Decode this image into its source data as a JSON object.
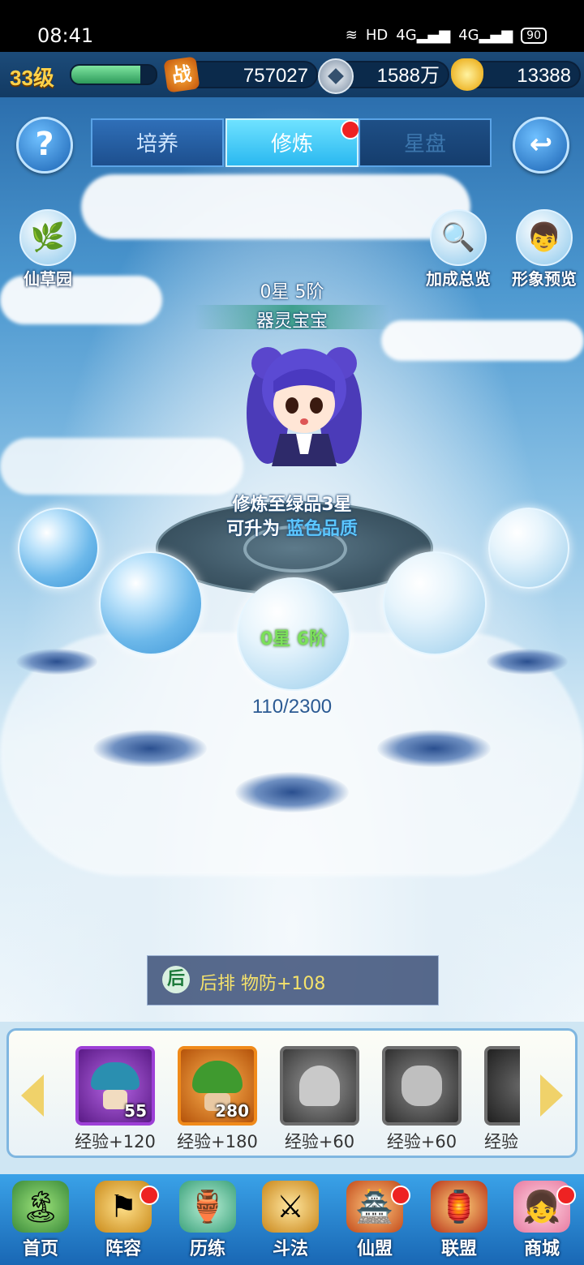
{
  "status_bar": {
    "time": "08:41",
    "network": "HD",
    "signal1": "4G",
    "signal2": "4G",
    "battery": "90"
  },
  "resources": {
    "level": "33级",
    "xp_fraction": 0.82,
    "combat_icon_text": "战",
    "combat_power": "757027",
    "silver": "1588万",
    "gold": "13388"
  },
  "tabs": [
    {
      "label": "培养",
      "state": "normal"
    },
    {
      "label": "修炼",
      "state": "active",
      "has_alert": true
    },
    {
      "label": "星盘",
      "state": "disabled"
    }
  ],
  "help_icon": "question-mark-icon",
  "back_icon": "back-arrow-icon",
  "side_buttons": {
    "herb_garden": "仙草园",
    "bonus_overview": "加成总览",
    "appearance_preview": "形象预览"
  },
  "spirit": {
    "rank": "0星 5阶",
    "name": "器灵宝宝",
    "cultivate_hint": "修炼至绿品3星",
    "upgrade_prefix": "可升为",
    "upgrade_quality": "蓝色品质",
    "next_stage": "0星 6阶",
    "progress_text": "110/2300",
    "progress_current": 110,
    "progress_max": 2300
  },
  "bonus": {
    "badge": "后",
    "text": "后排 物防+108"
  },
  "items": [
    {
      "icon": "mushroom-icon",
      "count": "55",
      "label": "经验+120",
      "rarity": "purple"
    },
    {
      "icon": "herb-icon",
      "count": "280",
      "label": "经验+180",
      "rarity": "orange"
    },
    {
      "icon": "lotus-icon",
      "count": "",
      "label": "经验+60",
      "rarity": "locked"
    },
    {
      "icon": "flower-pot-icon",
      "count": "",
      "label": "经验+60",
      "rarity": "locked"
    },
    {
      "icon": "lotus-dark-icon",
      "count": "",
      "label": "经验",
      "rarity": "locked"
    }
  ],
  "nav": [
    {
      "label": "首页",
      "icon": "island-icon",
      "alert": false
    },
    {
      "label": "阵容",
      "icon": "lineup-icon",
      "alert": true
    },
    {
      "label": "历练",
      "icon": "gourd-icon",
      "alert": false
    },
    {
      "label": "斗法",
      "icon": "sword-icon",
      "alert": false
    },
    {
      "label": "仙盟",
      "icon": "palace-icon",
      "alert": true
    },
    {
      "label": "联盟",
      "icon": "alliance-banner-icon",
      "alert": false
    },
    {
      "label": "商城",
      "icon": "shop-girl-icon",
      "alert": true
    }
  ],
  "colors": {
    "accent_green": "#7be05a",
    "accent_blue": "#5bc6ff",
    "alert_red": "#e22222"
  }
}
